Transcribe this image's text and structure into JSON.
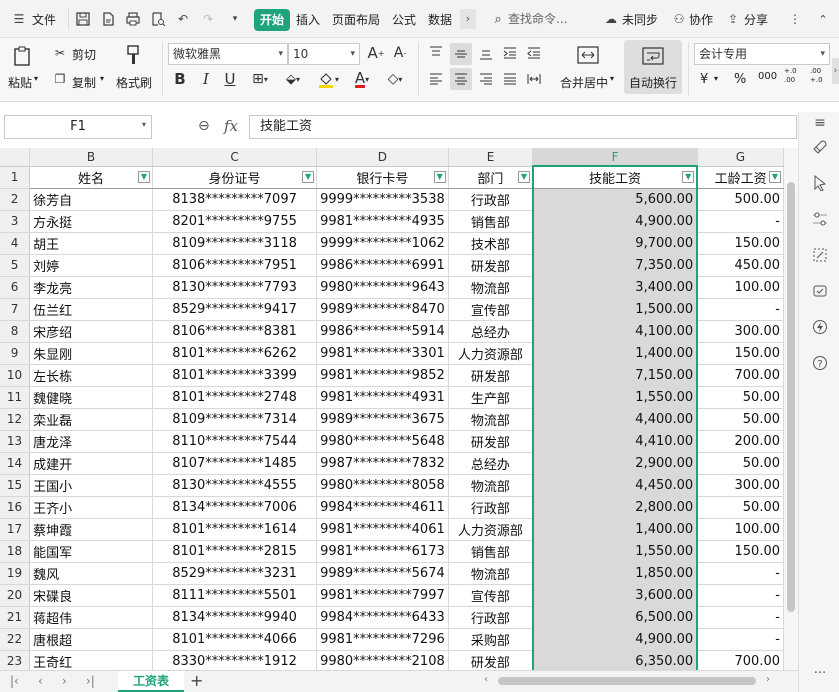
{
  "menubar": {
    "file": "文件",
    "tabs": [
      "开始",
      "插入",
      "页面布局",
      "公式",
      "数据"
    ],
    "search_placeholder": "查找命令...",
    "sync": "未同步",
    "collab": "协作",
    "share": "分享"
  },
  "ribbon": {
    "paste": "粘贴",
    "cut": "剪切",
    "copy": "复制",
    "format_painter": "格式刷",
    "font_name": "微软雅黑",
    "font_size": "10",
    "merge_center": "合并居中",
    "wrap_text": "自动换行",
    "number_format": "会计专用",
    "currency": "¥",
    "percent": "%",
    "thousands": "000",
    "inc_decimal": "+.0 .00",
    "dec_decimal": ".00 +.0"
  },
  "formula": {
    "cell_ref": "F1",
    "fx": "fx",
    "content": "技能工资"
  },
  "columns": [
    "B",
    "C",
    "D",
    "E",
    "F",
    "G"
  ],
  "headers": [
    "姓名",
    "身份证号",
    "银行卡号",
    "部门",
    "技能工资",
    "工龄工资"
  ],
  "rows": [
    {
      "n": "2",
      "name": "徐芳自",
      "id": "8138*********7097",
      "bank": "9999*********3538",
      "dept": "行政部",
      "skill": "5,600.00",
      "seniority": "500.00"
    },
    {
      "n": "3",
      "name": "方永挺",
      "id": "8201*********9755",
      "bank": "9981*********4935",
      "dept": "销售部",
      "skill": "4,900.00",
      "seniority": "-"
    },
    {
      "n": "4",
      "name": "胡王",
      "id": "8109*********3118",
      "bank": "9999*********1062",
      "dept": "技术部",
      "skill": "9,700.00",
      "seniority": "150.00"
    },
    {
      "n": "5",
      "name": "刘婷",
      "id": "8106*********7951",
      "bank": "9986*********6991",
      "dept": "研发部",
      "skill": "7,350.00",
      "seniority": "450.00"
    },
    {
      "n": "6",
      "name": "李龙亮",
      "id": "8130*********7793",
      "bank": "9980*********9643",
      "dept": "物流部",
      "skill": "3,400.00",
      "seniority": "100.00"
    },
    {
      "n": "7",
      "name": "伍兰红",
      "id": "8529*********9417",
      "bank": "9989*********8470",
      "dept": "宣传部",
      "skill": "1,500.00",
      "seniority": "-"
    },
    {
      "n": "8",
      "name": "宋彦绍",
      "id": "8106*********8381",
      "bank": "9986*********5914",
      "dept": "总经办",
      "skill": "4,100.00",
      "seniority": "300.00"
    },
    {
      "n": "9",
      "name": "朱显刚",
      "id": "8101*********6262",
      "bank": "9981*********3301",
      "dept": "人力资源部",
      "skill": "1,400.00",
      "seniority": "150.00"
    },
    {
      "n": "10",
      "name": "左长栋",
      "id": "8101*********3399",
      "bank": "9981*********9852",
      "dept": "研发部",
      "skill": "7,150.00",
      "seniority": "700.00"
    },
    {
      "n": "11",
      "name": "魏健晓",
      "id": "8101*********2748",
      "bank": "9981*********4931",
      "dept": "生产部",
      "skill": "1,550.00",
      "seniority": "50.00"
    },
    {
      "n": "12",
      "name": "栾业磊",
      "id": "8109*********7314",
      "bank": "9989*********3675",
      "dept": "物流部",
      "skill": "4,400.00",
      "seniority": "50.00"
    },
    {
      "n": "13",
      "name": "唐龙泽",
      "id": "8110*********7544",
      "bank": "9980*********5648",
      "dept": "研发部",
      "skill": "4,410.00",
      "seniority": "200.00"
    },
    {
      "n": "14",
      "name": "成建开",
      "id": "8107*********1485",
      "bank": "9987*********7832",
      "dept": "总经办",
      "skill": "2,900.00",
      "seniority": "50.00"
    },
    {
      "n": "15",
      "name": "王国小",
      "id": "8130*********4555",
      "bank": "9980*********8058",
      "dept": "物流部",
      "skill": "4,450.00",
      "seniority": "300.00"
    },
    {
      "n": "16",
      "name": "王齐小",
      "id": "8134*********7006",
      "bank": "9984*********4611",
      "dept": "行政部",
      "skill": "2,800.00",
      "seniority": "50.00"
    },
    {
      "n": "17",
      "name": "蔡坤霞",
      "id": "8101*********1614",
      "bank": "9981*********4061",
      "dept": "人力资源部",
      "skill": "1,400.00",
      "seniority": "100.00"
    },
    {
      "n": "18",
      "name": "能国军",
      "id": "8101*********2815",
      "bank": "9981*********6173",
      "dept": "销售部",
      "skill": "1,550.00",
      "seniority": "150.00"
    },
    {
      "n": "19",
      "name": "魏风",
      "id": "8529*********3231",
      "bank": "9989*********5674",
      "dept": "物流部",
      "skill": "1,850.00",
      "seniority": "-"
    },
    {
      "n": "20",
      "name": "宋碟良",
      "id": "8111*********5501",
      "bank": "9981*********7997",
      "dept": "宣传部",
      "skill": "3,600.00",
      "seniority": "-"
    },
    {
      "n": "21",
      "name": "蒋超伟",
      "id": "8134*********9940",
      "bank": "9984*********6433",
      "dept": "行政部",
      "skill": "6,500.00",
      "seniority": "-"
    },
    {
      "n": "22",
      "name": "唐根超",
      "id": "8101*********4066",
      "bank": "9981*********7296",
      "dept": "采购部",
      "skill": "4,900.00",
      "seniority": "-"
    },
    {
      "n": "23",
      "name": "王奇红",
      "id": "8330*********1912",
      "bank": "9980*********2108",
      "dept": "研发部",
      "skill": "6,350.00",
      "seniority": "700.00"
    }
  ],
  "sheet_tab": "工资表",
  "accent_color": "#1fa37a"
}
